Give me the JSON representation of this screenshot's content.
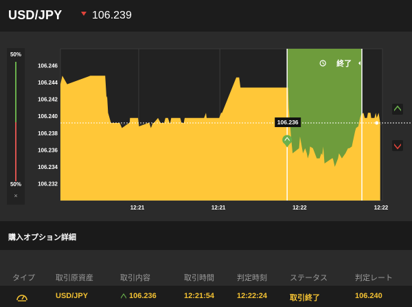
{
  "header": {
    "pair": "USD/JPY",
    "trend": "down",
    "price": "106.239"
  },
  "meter": {
    "top_label": "50%",
    "bottom_label": "50%",
    "close_label": "×"
  },
  "chart_data": {
    "type": "area",
    "y_ticks": [
      "106.246",
      "106.244",
      "106.242",
      "106.240",
      "106.238",
      "106.236",
      "106.234",
      "106.232"
    ],
    "x_ticks": [
      "12:21",
      "12:21",
      "12:22",
      "12:22"
    ],
    "ylim": [
      106.23,
      106.248
    ],
    "x": [
      0,
      0.6,
      2.1,
      9.3,
      9.7,
      10.5,
      11.8,
      13.9,
      14.3,
      14.5,
      14.8,
      15.7,
      18.4,
      19.1,
      21.3,
      21.5,
      21.6,
      24.1,
      24.4,
      27.3,
      27.6,
      28.1,
      28.7,
      29.0,
      30.3,
      31.1,
      32.2,
      32.6,
      33.4,
      33.9,
      34.1,
      34.4,
      34.7,
      35.6,
      37.2,
      37.6,
      38.3,
      38.6,
      39.0,
      44.6,
      45.2,
      45.4,
      45.8,
      49.3,
      49.9,
      50.2,
      54.6,
      55.3,
      55.5,
      55.9,
      62.6,
      63.3,
      63.6,
      63.7,
      70.7,
      70.9,
      71.6,
      72.1,
      74.1,
      74.4,
      75.3,
      76.0,
      76.5,
      76.8,
      77.3,
      77.5,
      78.4,
      79.6,
      80.5,
      81.0,
      81.3,
      81.6,
      82.0,
      84.3,
      84.6,
      85.2,
      86.2,
      86.5,
      87.4,
      88.5,
      89.3,
      89.7,
      90.5,
      90.8,
      91.5,
      91.8,
      92.5,
      93.0,
      93.4,
      94.1,
      94.5,
      95.2,
      95.5,
      96.3,
      96.5,
      96.8,
      97.5,
      97.9,
      98.2,
      98.8,
      99.3
    ],
    "y": [
      106.2438,
      106.2448,
      106.2438,
      106.2448,
      106.2448,
      106.2448,
      106.2448,
      106.2448,
      106.2422,
      106.2424,
      106.2404,
      106.2392,
      106.2392,
      106.2386,
      106.2392,
      106.2392,
      106.2398,
      106.2398,
      106.2388,
      106.2392,
      106.2392,
      106.2386,
      106.2392,
      106.2392,
      106.2398,
      106.2392,
      106.2392,
      106.2398,
      106.2398,
      106.2392,
      106.2392,
      106.2398,
      106.2398,
      106.2398,
      106.2398,
      106.2392,
      106.2392,
      106.2398,
      106.2398,
      106.2398,
      106.2404,
      106.2398,
      106.2398,
      106.2398,
      106.2404,
      106.2404,
      106.2446,
      106.2446,
      106.2446,
      106.2434,
      106.2434,
      106.2434,
      106.2434,
      106.2434,
      106.2434,
      106.241,
      106.2376,
      106.2356,
      106.2362,
      106.2376,
      106.2356,
      106.2362,
      106.2356,
      106.235,
      106.2356,
      106.2364,
      106.2362,
      106.235,
      106.235,
      106.2356,
      106.2354,
      106.2364,
      106.2344,
      106.235,
      106.235,
      106.234,
      106.235,
      106.2356,
      106.235,
      106.2356,
      106.2362,
      106.2362,
      106.2364,
      106.237,
      106.2382,
      106.2386,
      106.2388,
      106.2398,
      106.2402,
      106.2404,
      106.2398,
      106.2398,
      106.2404,
      106.2404,
      106.2398,
      106.2398,
      106.2398,
      106.2404,
      106.2398,
      106.2404,
      106.2392
    ],
    "entry_x": 70.4,
    "expiry_x": 93.6,
    "current_rate_value": 106.2392,
    "current_rate_label": "106.236",
    "marker_value": 106.2372,
    "end_label": "終了",
    "colors": {
      "area": "#ffc738",
      "window": "#6e9c3c",
      "grid": "#3a3a3a",
      "plot_bg": "#222222",
      "up": "#6ab04c",
      "down": "#e0433a"
    }
  },
  "details": {
    "title": "購入オプション詳細"
  },
  "table": {
    "headers": [
      "タイプ",
      "取引原資産",
      "取引内容",
      "取引時間",
      "判定時刻",
      "ステータス",
      "判定レート"
    ],
    "rows": [
      {
        "type_icon": "gauge-icon",
        "asset": "USD/JPY",
        "direction": "up",
        "content": "106.236",
        "trade_time": "12:21:54",
        "judge_time": "12:22:24",
        "status": "取引終了",
        "rate": "106.240"
      }
    ]
  }
}
